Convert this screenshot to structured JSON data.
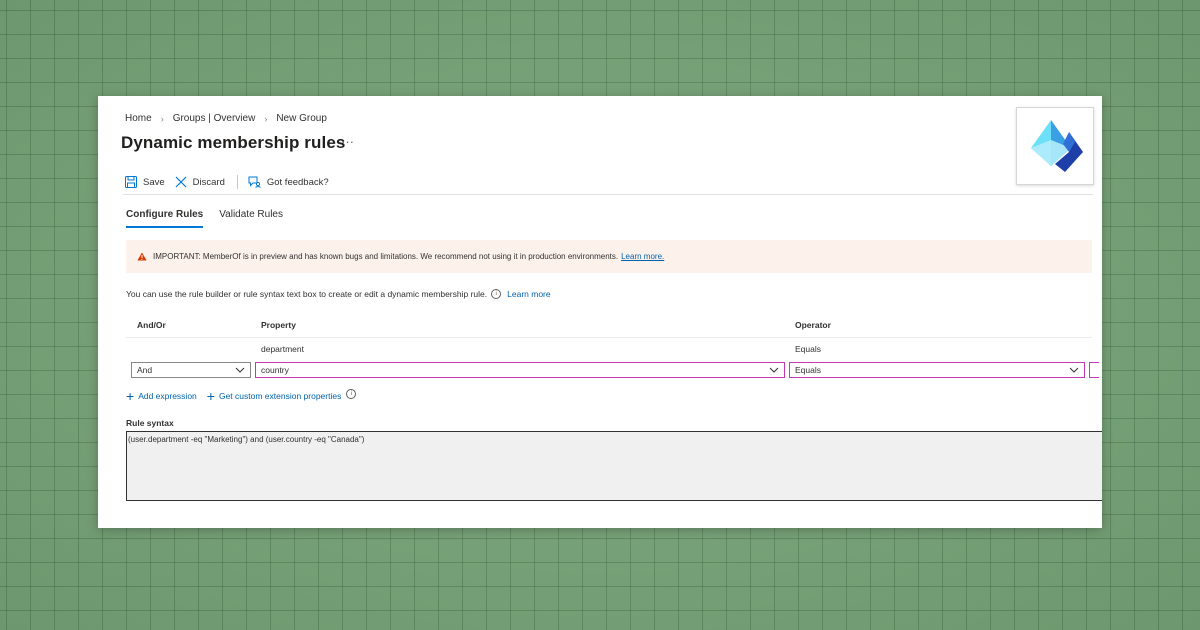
{
  "breadcrumb": [
    "Home",
    "Groups | Overview",
    "New Group"
  ],
  "page_title": "Dynamic membership rules",
  "more_label": "···",
  "toolbar": {
    "save_label": "Save",
    "discard_label": "Discard",
    "feedback_label": "Got feedback?"
  },
  "tabs": [
    {
      "label": "Configure Rules",
      "active": true
    },
    {
      "label": "Validate Rules",
      "active": false
    }
  ],
  "warning": {
    "text": "IMPORTANT: MemberOf is in preview and has known bugs and limitations. We recommend not using it in production environments.",
    "link": "Learn more."
  },
  "intro": {
    "text": "You can use the rule builder or rule syntax text box to create or edit a dynamic membership rule.",
    "link": "Learn more"
  },
  "rule_builder": {
    "headers": {
      "and_or": "And/Or",
      "property": "Property",
      "operator": "Operator"
    },
    "rows": [
      {
        "and_or": "",
        "property": "department",
        "operator": "Equals"
      }
    ],
    "edit_row": {
      "and_or": "And",
      "property": "country",
      "operator": "Equals"
    }
  },
  "actions": {
    "add_expression": "Add expression",
    "custom_ext": "Get custom extension properties"
  },
  "rule_syntax": {
    "label": "Rule syntax",
    "value": "(user.department -eq \"Marketing\") and (user.country -eq \"Canada\")"
  },
  "colors": {
    "accent": "#0078d4",
    "link": "#0062ad",
    "warning_bg": "#fdf1ec",
    "warning_icon": "#d83b01",
    "focus_border": "#c239b3"
  },
  "logo": {
    "icon": "entra-id-logo-icon"
  }
}
